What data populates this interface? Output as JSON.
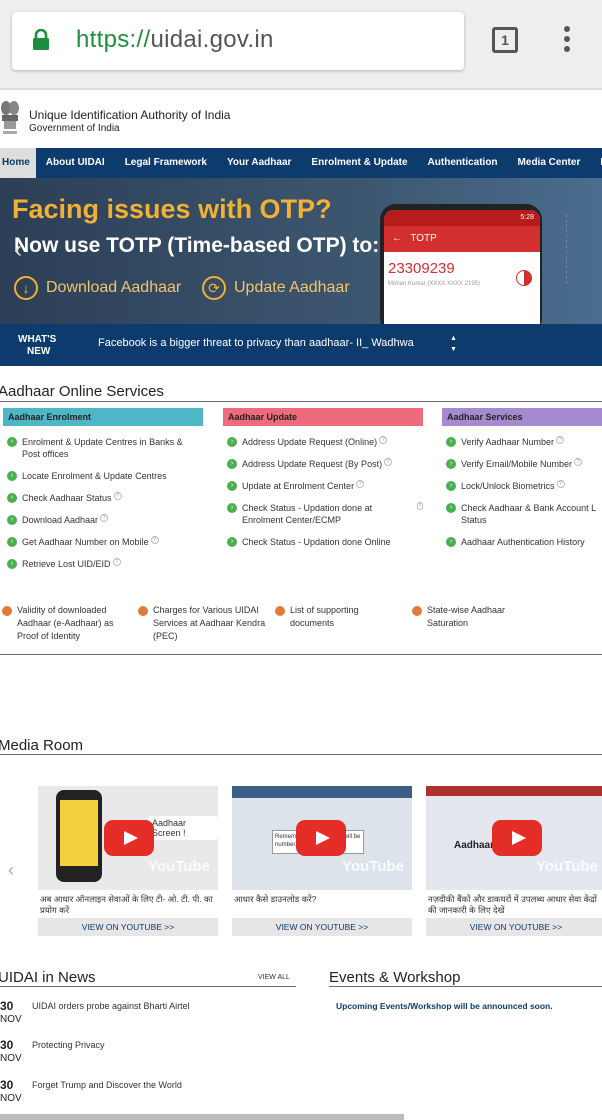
{
  "browser": {
    "url_scheme": "https://",
    "url_host": "uidai.gov.in",
    "tab_count": "1"
  },
  "header": {
    "org_name": "Unique Identification Authority of India",
    "org_sub": "Government of India"
  },
  "nav": {
    "items": [
      "Home",
      "About UIDAI",
      "Legal Framework",
      "Your Aadhaar",
      "Enrolment & Update",
      "Authentication",
      "Media Center",
      "Resou"
    ]
  },
  "banner": {
    "title": "Facing issues with OTP?",
    "subtitle": "Now use TOTP (Time-based OTP) to:",
    "download_label": "Download Aadhaar",
    "update_label": "Update Aadhaar",
    "phone_status": "5:28",
    "phone_header": "TOTP",
    "phone_code": "23309239",
    "phone_name": "Mohan Kumar     (XXXX XXXX 2195)",
    "colors": {
      "title": "#f2b134",
      "accent": "#d32f2f"
    }
  },
  "whats_new": {
    "label_line1": "WHAT'S",
    "label_line2": "NEW",
    "ticker": "Facebook is a bigger threat to privacy than aadhaar- II_ Wadhwa"
  },
  "online_services": {
    "title": "Aadhaar Online Services",
    "columns": [
      {
        "heading": "Aadhaar Enrolment",
        "color": "#4fb6c6",
        "items": [
          "Enrolment & Update Centres in Banks & Post offices",
          "Locate Enrolment & Update Centres",
          "Check Aadhaar Status",
          "Download Aadhaar",
          "Get Aadhaar Number on Mobile",
          "Retrieve Lost UID/EID"
        ]
      },
      {
        "heading": "Aadhaar Update",
        "color": "#ee6b7b",
        "items": [
          "Address Update Request (Online)",
          "Address Update Request (By Post)",
          "Update at Enrolment Center",
          "Check Status - Updation done at Enrolment Center/ECMP",
          "Check Status - Updation done Online"
        ]
      },
      {
        "heading": "Aadhaar Services",
        "color": "#a68ad0",
        "items": [
          "Verify Aadhaar Number",
          "Verify Email/Mobile Number",
          "Lock/Unlock Biometrics",
          "Check Aadhaar & Bank Account L Status",
          "Aadhaar Authentication History"
        ]
      }
    ],
    "extras": [
      "Validity of downloaded Aadhaar (e-Aadhaar) as Proof of Identity",
      "Charges for Various UIDAI Services at Aadhaar Kendra (PEC)",
      "List of supporting documents",
      "State-wise Aadhaar Saturation"
    ]
  },
  "media_room": {
    "title": "Media Room",
    "cards": [
      {
        "caption": "अब आधार ऑनलाइन सेवाओं के लिए टी- ओ. टी. पी. का प्रयोग करें",
        "button": "VIEW ON YOUTUBE >>",
        "thumb_text": "Aadhaar Screen !"
      },
      {
        "caption": "आधार कैसे डाउनलोड करें?",
        "button": "VIEW ON YOUTUBE >>",
        "thumb_text": "Remember the password will be number."
      },
      {
        "caption": "नज़दीकी बैंकों और डाकघरों में उपलब्ध आधार सेवा केंद्रों की जानकारी के लिए देखें",
        "button": "VIEW ON YOUTUBE >>",
        "thumb_text": "Aadhaar"
      }
    ],
    "youtube_word": "YouTube"
  },
  "news": {
    "title": "UIDAI in News",
    "view_all": "VIEW ALL",
    "items": [
      {
        "day": "30",
        "month": "NOV",
        "text": "UIDAI orders probe against Bharti Airtel"
      },
      {
        "day": "30",
        "month": "NOV",
        "text": "Protecting Privacy"
      },
      {
        "day": "30",
        "month": "NOV",
        "text": "Forget Trump and Discover the World"
      }
    ]
  },
  "events": {
    "title": "Events & Workshop",
    "message": "Upcoming Events/Workshop will be announced soon."
  }
}
